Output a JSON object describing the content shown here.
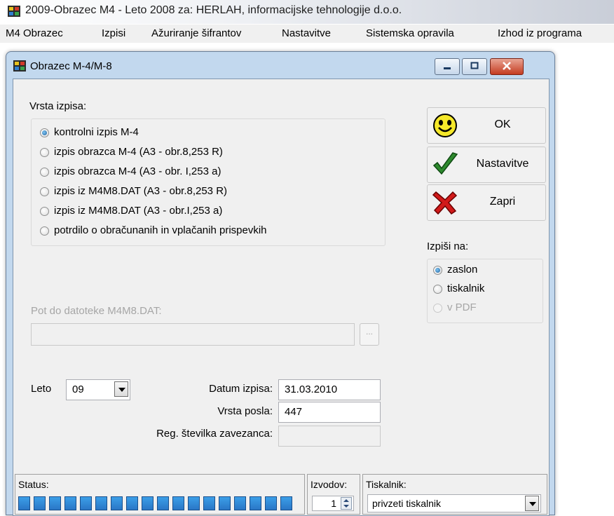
{
  "app": {
    "title": "2009-Obrazec M4 - Leto 2008 za: HERLAH, informacijske tehnologije d.o.o."
  },
  "menu": [
    "M4 Obrazec",
    "Izpisi",
    "Ažuriranje šifrantov",
    "Nastavitve",
    "Sistemska opravila",
    "Izhod iz programa"
  ],
  "dialog": {
    "title": "Obrazec M-4/M-8",
    "vrsta_izpisa": {
      "label": "Vrsta izpisa:",
      "options": [
        {
          "label": "kontrolni izpis M-4",
          "checked": true
        },
        {
          "label": "izpis obrazca M-4 (A3 - obr.8,253 R)",
          "checked": false
        },
        {
          "label": "izpis obrazca M-4 (A3 - obr. I,253 a)",
          "checked": false
        },
        {
          "label": "izpis iz M4M8.DAT (A3 - obr.8,253 R)",
          "checked": false
        },
        {
          "label": "izpis iz M4M8.DAT (A3 - obr.I,253 a)",
          "checked": false
        },
        {
          "label": "potrdilo o obračunanih in vplačanih prispevkih",
          "checked": false
        }
      ]
    },
    "buttons": {
      "ok": "OK",
      "nastavitve": "Nastavitve",
      "zapri": "Zapri",
      "browse": "..."
    },
    "izpisi_na": {
      "label": "Izpiši na:",
      "options": [
        {
          "label": "zaslon",
          "checked": true,
          "enabled": true
        },
        {
          "label": "tiskalnik",
          "checked": false,
          "enabled": true
        },
        {
          "label": "v PDF",
          "checked": false,
          "enabled": false
        }
      ]
    },
    "pot": {
      "label": "Pot do datoteke M4M8.DAT:",
      "value": ""
    },
    "leto": {
      "label": "Leto",
      "value": "09"
    },
    "datum_izpisa": {
      "label": "Datum izpisa:",
      "value": "31.03.2010"
    },
    "vrsta_posla": {
      "label": "Vrsta posla:",
      "value": "447"
    },
    "reg_stevilka": {
      "label": "Reg. številka zavezanca:",
      "value": ""
    },
    "status": {
      "label": "Status:",
      "progress": 1.0,
      "segments": 18
    },
    "izvodov": {
      "label": "Izvodov:",
      "value": "1"
    },
    "tiskalnik": {
      "label": "Tiskalnik:",
      "value": "privzeti tiskalnik"
    }
  }
}
